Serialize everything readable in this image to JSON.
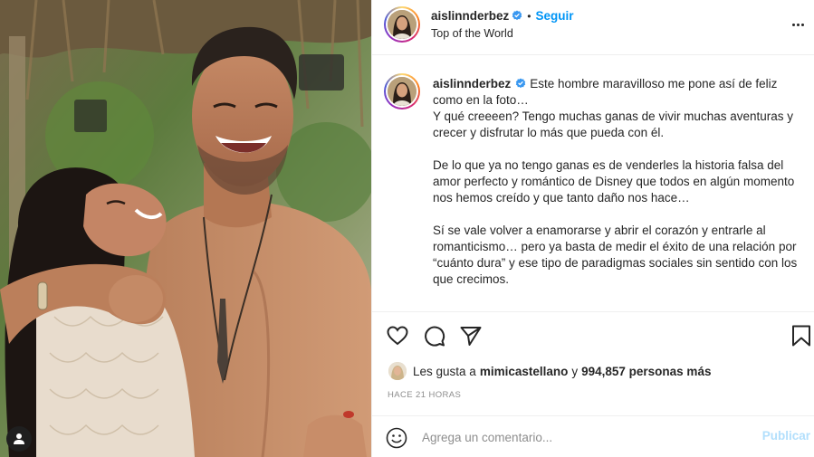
{
  "post": {
    "username": "aislinnderbez",
    "follow_label": "Seguir",
    "separator": "•",
    "location": "Top of the World",
    "caption_paragraphs": [
      "Este hombre maravilloso me pone así de feliz como en la foto…\nY qué creeeen? Tengo muchas ganas de vivir muchas aventuras y crecer y disfrutar lo más que pueda con él.",
      "De lo que ya no tengo ganas es de venderles la historia falsa del amor perfecto y romántico de Disney que todos en algún momento nos hemos creído y que tanto daño nos hace…",
      "Sí se vale volver a enamorarse y abrir el corazón y entrarle al romanticismo… pero ya basta de medir el éxito de una relación por “cuánto dura” y ese tipo de paradigmas sociales sin sentido con los que crecimos."
    ],
    "likes": {
      "prefix": "Les gusta a",
      "liker": "mimicastellano",
      "connector": "y",
      "count_text": "994,857 personas más"
    },
    "timestamp": "HACE 21 HORAS"
  },
  "comment": {
    "placeholder": "Agrega un comentario...",
    "publish_label": "Publicar"
  },
  "colors": {
    "link_blue": "#0095f6",
    "publish_disabled": "#b2dffc",
    "text": "#262626",
    "muted": "#8e8e8e",
    "verified": "#3897f0"
  },
  "icons": {
    "like": "heart-icon",
    "comment": "comment-icon",
    "share": "paper-plane-icon",
    "save": "bookmark-icon",
    "emoji": "smiley-icon",
    "more": "more-options-icon",
    "verified": "verified-badge-icon",
    "tagged": "user-tag-icon"
  }
}
